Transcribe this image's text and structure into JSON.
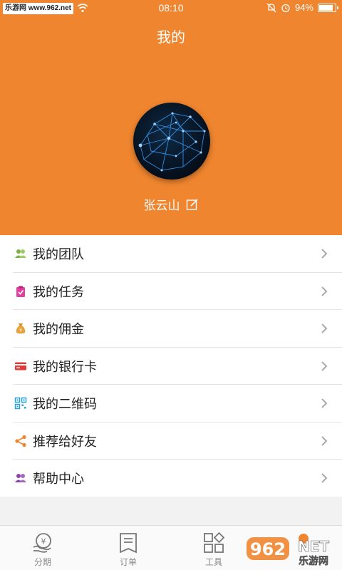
{
  "status_bar": {
    "watermark": "乐游网 www.962.net",
    "time": "08:10",
    "battery": "94%"
  },
  "header": {
    "title": "我的",
    "username": "张云山"
  },
  "menu": {
    "items": [
      {
        "label": "我的团队",
        "icon": "team-icon",
        "color": "#7cb342"
      },
      {
        "label": "我的任务",
        "icon": "task-icon",
        "color": "#e040a0"
      },
      {
        "label": "我的佣金",
        "icon": "commission-icon",
        "color": "#e6a23c"
      },
      {
        "label": "我的银行卡",
        "icon": "bank-card-icon",
        "color": "#e53935"
      },
      {
        "label": "我的二维码",
        "icon": "qr-code-icon",
        "color": "#29a0d8"
      },
      {
        "label": "推荐给好友",
        "icon": "share-icon",
        "color": "#f0852f"
      },
      {
        "label": "帮助中心",
        "icon": "help-icon",
        "color": "#8e44ad"
      }
    ]
  },
  "tabs": [
    {
      "label": "分期",
      "icon": "installment-icon"
    },
    {
      "label": "订单",
      "icon": "order-icon"
    },
    {
      "label": "工具",
      "icon": "tools-icon"
    },
    {
      "label": "",
      "icon": "mine-icon"
    }
  ],
  "watermark_bottom": {
    "text_top": "962",
    "text_net": "NET",
    "text_bottom": "乐游网"
  },
  "colors": {
    "accent": "#f0852f",
    "background": "#f2f2f2"
  }
}
